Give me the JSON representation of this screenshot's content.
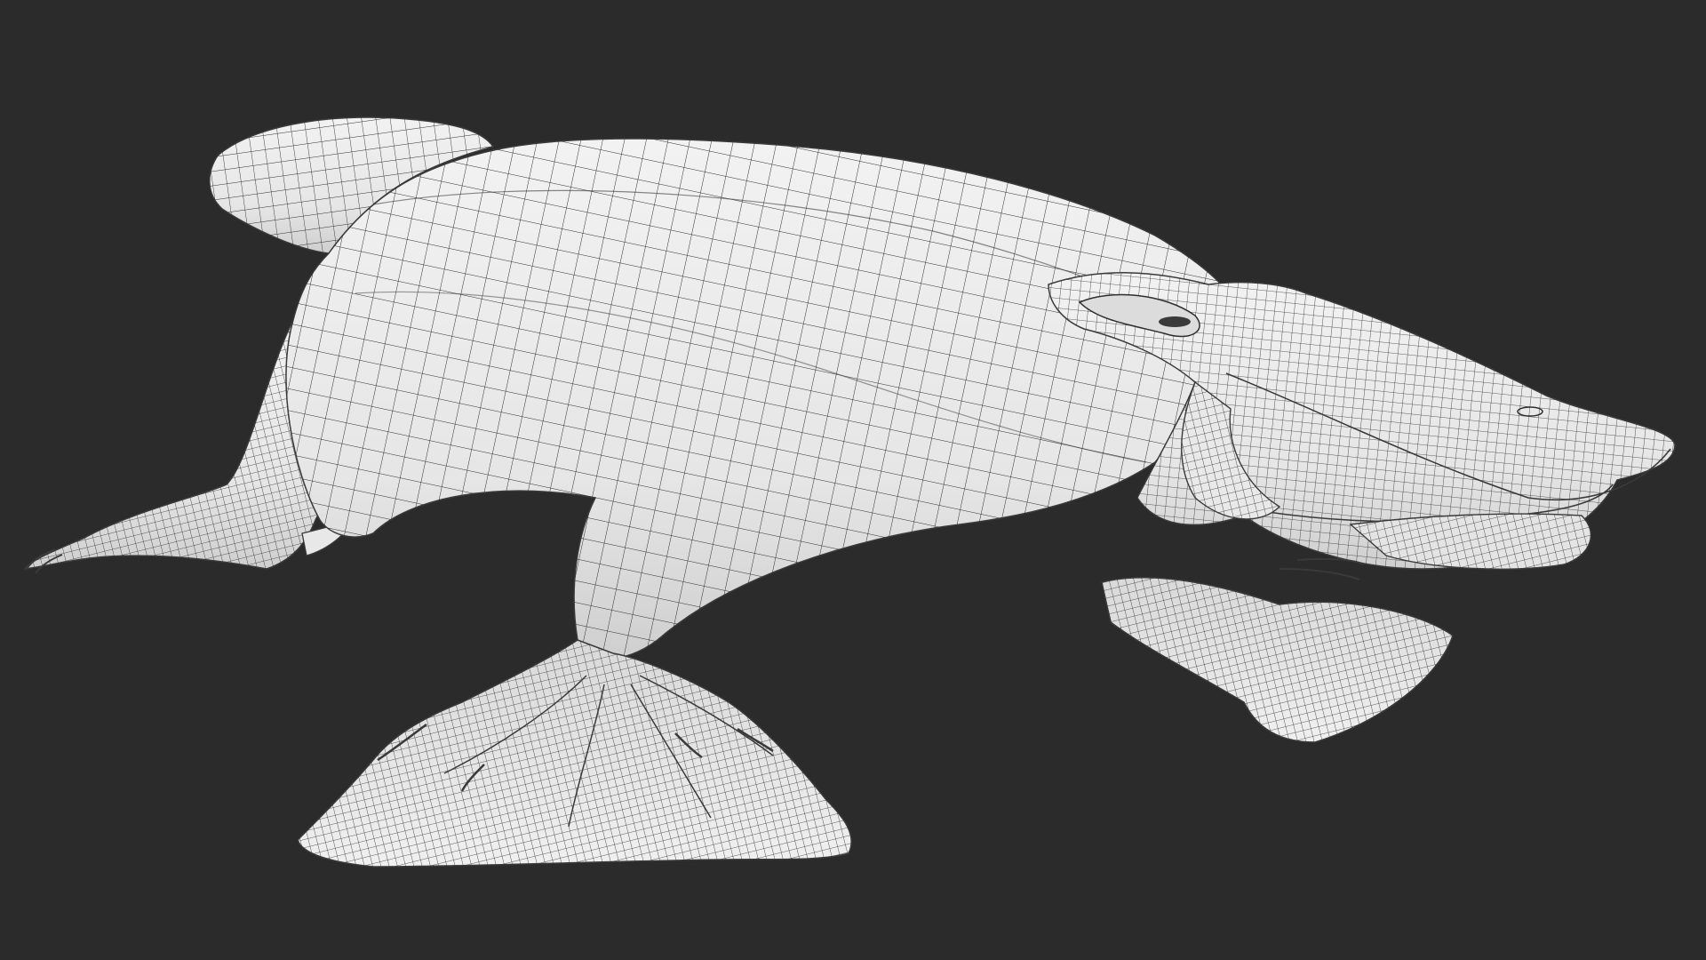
{
  "viewport": {
    "background": "#2b2b2b",
    "subject": "platypus-wireframe-mesh",
    "mesh_fill": "#ececec",
    "mesh_line": "#2e2e2e",
    "shading": "#d2d2d2"
  }
}
